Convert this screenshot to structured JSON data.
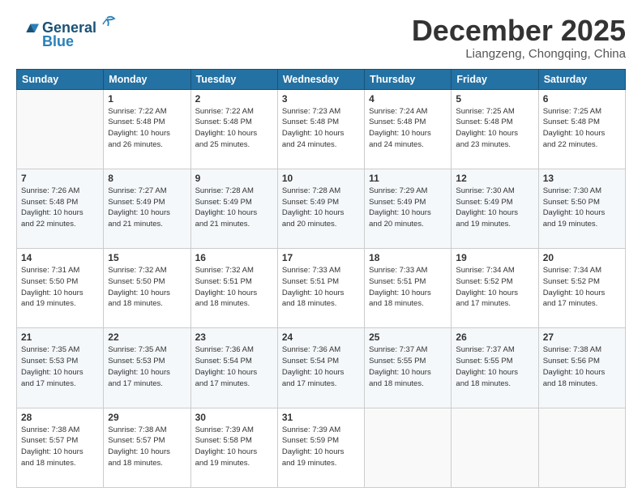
{
  "header": {
    "logo_line1": "General",
    "logo_line2": "Blue",
    "month": "December 2025",
    "location": "Liangzeng, Chongqing, China"
  },
  "weekdays": [
    "Sunday",
    "Monday",
    "Tuesday",
    "Wednesday",
    "Thursday",
    "Friday",
    "Saturday"
  ],
  "weeks": [
    [
      {
        "day": "",
        "info": ""
      },
      {
        "day": "1",
        "info": "Sunrise: 7:22 AM\nSunset: 5:48 PM\nDaylight: 10 hours\nand 26 minutes."
      },
      {
        "day": "2",
        "info": "Sunrise: 7:22 AM\nSunset: 5:48 PM\nDaylight: 10 hours\nand 25 minutes."
      },
      {
        "day": "3",
        "info": "Sunrise: 7:23 AM\nSunset: 5:48 PM\nDaylight: 10 hours\nand 24 minutes."
      },
      {
        "day": "4",
        "info": "Sunrise: 7:24 AM\nSunset: 5:48 PM\nDaylight: 10 hours\nand 24 minutes."
      },
      {
        "day": "5",
        "info": "Sunrise: 7:25 AM\nSunset: 5:48 PM\nDaylight: 10 hours\nand 23 minutes."
      },
      {
        "day": "6",
        "info": "Sunrise: 7:25 AM\nSunset: 5:48 PM\nDaylight: 10 hours\nand 22 minutes."
      }
    ],
    [
      {
        "day": "7",
        "info": "Sunrise: 7:26 AM\nSunset: 5:48 PM\nDaylight: 10 hours\nand 22 minutes."
      },
      {
        "day": "8",
        "info": "Sunrise: 7:27 AM\nSunset: 5:49 PM\nDaylight: 10 hours\nand 21 minutes."
      },
      {
        "day": "9",
        "info": "Sunrise: 7:28 AM\nSunset: 5:49 PM\nDaylight: 10 hours\nand 21 minutes."
      },
      {
        "day": "10",
        "info": "Sunrise: 7:28 AM\nSunset: 5:49 PM\nDaylight: 10 hours\nand 20 minutes."
      },
      {
        "day": "11",
        "info": "Sunrise: 7:29 AM\nSunset: 5:49 PM\nDaylight: 10 hours\nand 20 minutes."
      },
      {
        "day": "12",
        "info": "Sunrise: 7:30 AM\nSunset: 5:49 PM\nDaylight: 10 hours\nand 19 minutes."
      },
      {
        "day": "13",
        "info": "Sunrise: 7:30 AM\nSunset: 5:50 PM\nDaylight: 10 hours\nand 19 minutes."
      }
    ],
    [
      {
        "day": "14",
        "info": "Sunrise: 7:31 AM\nSunset: 5:50 PM\nDaylight: 10 hours\nand 19 minutes."
      },
      {
        "day": "15",
        "info": "Sunrise: 7:32 AM\nSunset: 5:50 PM\nDaylight: 10 hours\nand 18 minutes."
      },
      {
        "day": "16",
        "info": "Sunrise: 7:32 AM\nSunset: 5:51 PM\nDaylight: 10 hours\nand 18 minutes."
      },
      {
        "day": "17",
        "info": "Sunrise: 7:33 AM\nSunset: 5:51 PM\nDaylight: 10 hours\nand 18 minutes."
      },
      {
        "day": "18",
        "info": "Sunrise: 7:33 AM\nSunset: 5:51 PM\nDaylight: 10 hours\nand 18 minutes."
      },
      {
        "day": "19",
        "info": "Sunrise: 7:34 AM\nSunset: 5:52 PM\nDaylight: 10 hours\nand 17 minutes."
      },
      {
        "day": "20",
        "info": "Sunrise: 7:34 AM\nSunset: 5:52 PM\nDaylight: 10 hours\nand 17 minutes."
      }
    ],
    [
      {
        "day": "21",
        "info": "Sunrise: 7:35 AM\nSunset: 5:53 PM\nDaylight: 10 hours\nand 17 minutes."
      },
      {
        "day": "22",
        "info": "Sunrise: 7:35 AM\nSunset: 5:53 PM\nDaylight: 10 hours\nand 17 minutes."
      },
      {
        "day": "23",
        "info": "Sunrise: 7:36 AM\nSunset: 5:54 PM\nDaylight: 10 hours\nand 17 minutes."
      },
      {
        "day": "24",
        "info": "Sunrise: 7:36 AM\nSunset: 5:54 PM\nDaylight: 10 hours\nand 17 minutes."
      },
      {
        "day": "25",
        "info": "Sunrise: 7:37 AM\nSunset: 5:55 PM\nDaylight: 10 hours\nand 18 minutes."
      },
      {
        "day": "26",
        "info": "Sunrise: 7:37 AM\nSunset: 5:55 PM\nDaylight: 10 hours\nand 18 minutes."
      },
      {
        "day": "27",
        "info": "Sunrise: 7:38 AM\nSunset: 5:56 PM\nDaylight: 10 hours\nand 18 minutes."
      }
    ],
    [
      {
        "day": "28",
        "info": "Sunrise: 7:38 AM\nSunset: 5:57 PM\nDaylight: 10 hours\nand 18 minutes."
      },
      {
        "day": "29",
        "info": "Sunrise: 7:38 AM\nSunset: 5:57 PM\nDaylight: 10 hours\nand 18 minutes."
      },
      {
        "day": "30",
        "info": "Sunrise: 7:39 AM\nSunset: 5:58 PM\nDaylight: 10 hours\nand 19 minutes."
      },
      {
        "day": "31",
        "info": "Sunrise: 7:39 AM\nSunset: 5:59 PM\nDaylight: 10 hours\nand 19 minutes."
      },
      {
        "day": "",
        "info": ""
      },
      {
        "day": "",
        "info": ""
      },
      {
        "day": "",
        "info": ""
      }
    ]
  ]
}
